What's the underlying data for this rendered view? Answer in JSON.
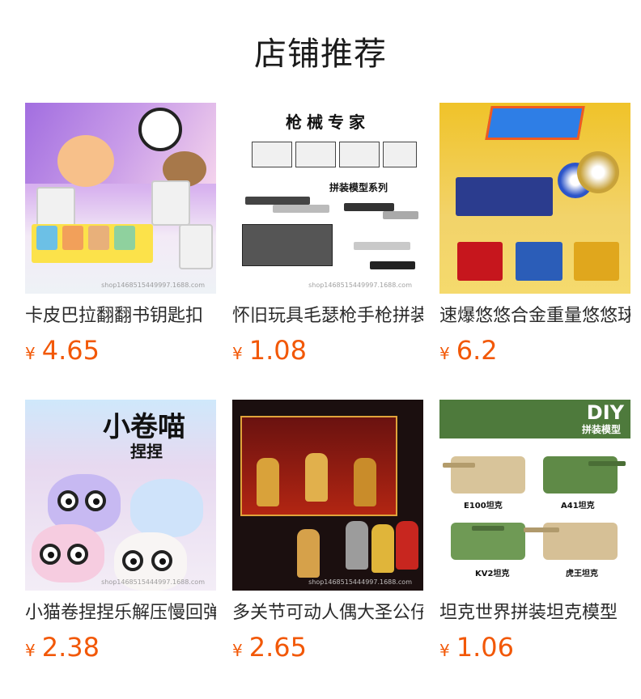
{
  "section": {
    "title": "店铺推荐"
  },
  "currency_symbol": "¥",
  "accent_color": "#f25807",
  "products": [
    {
      "name": "卡皮巴拉翻翻书钥匙扣",
      "price": "4.65"
    },
    {
      "name": "怀旧玩具毛瑟枪手枪拼装模型",
      "price": "1.08"
    },
    {
      "name": "速爆悠悠合金重量悠悠球",
      "price": "6.2"
    },
    {
      "name": "小猫卷捏捏乐解压慢回弹玩具",
      "price": "2.38"
    },
    {
      "name": "多关节可动人偶大圣公仔",
      "price": "2.65"
    },
    {
      "name": "坦克世界拼装坦克模型",
      "price": "1.06"
    }
  ],
  "image_text": {
    "p1_watermark": "shop1468515449997.1688.com",
    "p2_heading": "枪械专家",
    "p2_series": "拼装模型系列",
    "p2_watermark": "shop1468515449997.1688.com",
    "p4_title": "小卷喵",
    "p4_sub": "捏捏",
    "p4_watermark": "shop1468515444997.1688.com",
    "p5_watermark": "shop1468515444997.1688.com",
    "p6_badge": "DIY",
    "p6_sub": "拼装模型",
    "p6_labels": [
      "E100坦克",
      "A41坦克",
      "KV2坦克",
      "虎王坦克"
    ]
  }
}
